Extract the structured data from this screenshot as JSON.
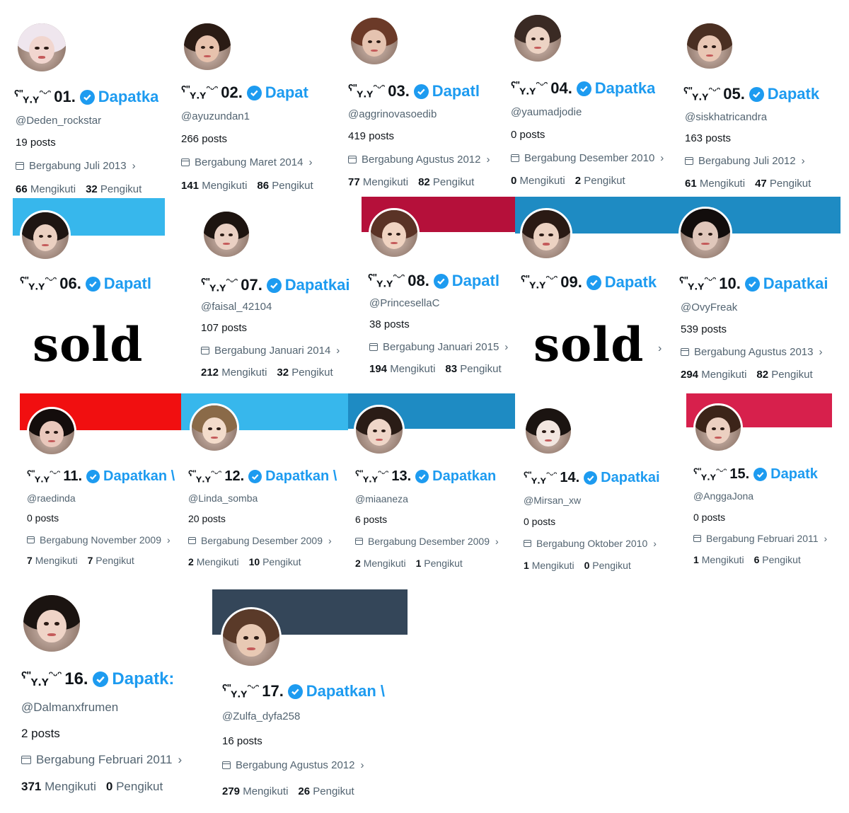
{
  "kaomoji": {
    "ear": "ʕ\"",
    "eyes": "ʏ.ʏ",
    "paw": "ᵔᵕᵔ"
  },
  "colors": {
    "link": "#1d9bf0",
    "muted": "#536471",
    "text": "#0f1419"
  },
  "sold_label": "sold",
  "accounts": [
    {
      "num": "01.",
      "verify": "Dapatka",
      "handle": "@Deden_rockstar",
      "posts": "19 posts",
      "joined": "Bergabung Juli 2013",
      "following": "66",
      "following_label": "Mengikuti",
      "followers": "32",
      "followers_label": "Pengikut"
    },
    {
      "num": "02.",
      "verify": "Dapat",
      "handle": "@ayuzundan1",
      "posts": "266 posts",
      "joined": "Bergabung Maret 2014",
      "following": "141",
      "following_label": "Mengikuti",
      "followers": "86",
      "followers_label": "Pengikut"
    },
    {
      "num": "03.",
      "verify": "Dapatl",
      "handle": "@aggrinovasoedib",
      "posts": "419 posts",
      "joined": "Bergabung Agustus 2012",
      "following": "77",
      "following_label": "Mengikuti",
      "followers": "82",
      "followers_label": "Pengikut"
    },
    {
      "num": "04.",
      "verify": "Dapatka",
      "handle": "@yaumadjodie",
      "posts": "0 posts",
      "joined": "Bergabung Desember 2010",
      "following": "0",
      "following_label": "Mengikuti",
      "followers": "2",
      "followers_label": "Pengikut"
    },
    {
      "num": "05.",
      "verify": "Dapatk",
      "handle": "@siskhatricandra",
      "posts": "163 posts",
      "joined": "Bergabung Juli 2012",
      "following": "61",
      "following_label": "Mengikuti",
      "followers": "47",
      "followers_label": "Pengikut"
    },
    {
      "num": "06.",
      "verify": "Dapatl",
      "handle": "",
      "posts": "",
      "joined": "",
      "following": "",
      "following_label": "",
      "followers": "",
      "followers_label": ""
    },
    {
      "num": "07.",
      "verify": "Dapatkai",
      "handle": "@faisal_42104",
      "posts": "107 posts",
      "joined": "Bergabung Januari 2014",
      "following": "212",
      "following_label": "Mengikuti",
      "followers": "32",
      "followers_label": "Pengikut"
    },
    {
      "num": "08.",
      "verify": "Dapatl",
      "handle": "@PrincesellaC",
      "posts": "38 posts",
      "joined": "Bergabung Januari 2015",
      "following": "194",
      "following_label": "Mengikuti",
      "followers": "83",
      "followers_label": "Pengikut"
    },
    {
      "num": "09.",
      "verify": "Dapatk",
      "handle": "",
      "posts": "",
      "joined": "",
      "following": "",
      "following_label": "",
      "followers": "",
      "followers_label": ""
    },
    {
      "num": "10.",
      "verify": "Dapatkai",
      "handle": "@OvyFreak",
      "posts": "539 posts",
      "joined": "Bergabung Agustus 2013",
      "following": "294",
      "following_label": "Mengikuti",
      "followers": "82",
      "followers_label": "Pengikut"
    },
    {
      "num": "11.",
      "verify": "Dapatkan \\",
      "handle": "@raedinda",
      "posts": "0 posts",
      "joined": "Bergabung November 2009",
      "following": "7",
      "following_label": "Mengikuti",
      "followers": "7",
      "followers_label": "Pengikut"
    },
    {
      "num": "12.",
      "verify": "Dapatkan \\",
      "handle": "@Linda_somba",
      "posts": "20 posts",
      "joined": "Bergabung Desember 2009",
      "following": "2",
      "following_label": "Mengikuti",
      "followers": "10",
      "followers_label": "Pengikut"
    },
    {
      "num": "13.",
      "verify": "Dapatkan",
      "handle": "@miaaneza",
      "posts": "6 posts",
      "joined": "Bergabung Desember 2009",
      "following": "2",
      "following_label": "Mengikuti",
      "followers": "1",
      "followers_label": "Pengikut"
    },
    {
      "num": "14.",
      "verify": "Dapatkai",
      "handle": "@Mirsan_xw",
      "posts": "0 posts",
      "joined": "Bergabung Oktober 2010",
      "following": "1",
      "following_label": "Mengikuti",
      "followers": "0",
      "followers_label": "Pengikut"
    },
    {
      "num": "15.",
      "verify": "Dapatk",
      "handle": "@AnggaJona",
      "posts": "0 posts",
      "joined": "Bergabung Februari 2011",
      "following": "1",
      "following_label": "Mengikuti",
      "followers": "6",
      "followers_label": "Pengikut"
    },
    {
      "num": "16.",
      "verify": "Dapatk:",
      "handle": "@Dalmanxfrumen",
      "posts": "2 posts",
      "joined": "Bergabung Februari 2011",
      "following": "371",
      "following_label": "Mengikuti",
      "followers": "0",
      "followers_label": "Pengikut"
    },
    {
      "num": "17.",
      "verify": "Dapatkan \\",
      "handle": "@Zulfa_dyfa258",
      "posts": "16 posts",
      "joined": "Bergabung Agustus 2012",
      "following": "279",
      "following_label": "Mengikuti",
      "followers": "26",
      "followers_label": "Pengikut"
    }
  ]
}
